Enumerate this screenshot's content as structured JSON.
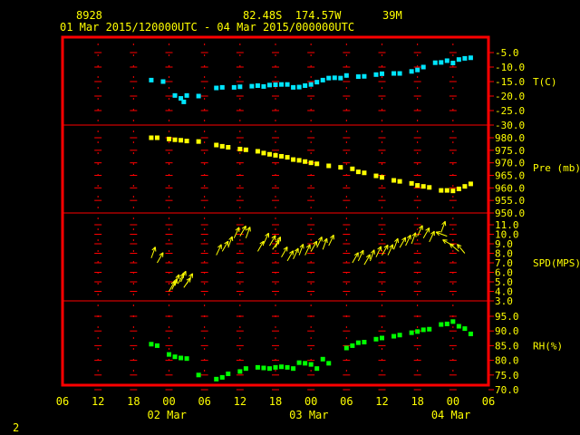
{
  "header": {
    "station": "8928",
    "location": "82.48S  174.57W",
    "elevation": "39M",
    "period": "01 Mar 2015/120000UTC - 04 Mar 2015/000000UTC"
  },
  "footer": {
    "page_number": "2"
  },
  "colors": {
    "background": "#000000",
    "frame": "#ff0000",
    "text": "#ffff00",
    "grid": "#ff0000",
    "temp": "#00e5ff",
    "pressure": "#ffff00",
    "wind": "#ffff00",
    "rh": "#00ff00"
  },
  "x_axis": {
    "tick_labels": [
      "06",
      "12",
      "18",
      "00",
      "06",
      "12",
      "18",
      "00",
      "06",
      "12",
      "18",
      "00",
      "06"
    ],
    "date_labels": [
      {
        "text": "02 Mar",
        "hour_index": 3
      },
      {
        "text": "03 Mar",
        "hour_index": 7
      },
      {
        "text": "04 Mar",
        "hour_index": 11
      }
    ]
  },
  "chart_data": [
    {
      "type": "scatter",
      "name": "temperature",
      "label": "T(C)",
      "ylim": [
        -30,
        -5
      ],
      "yticks": [
        "-5.0",
        "-10.0",
        "-15.0",
        "-20.0",
        "-25.0",
        "-30.0"
      ],
      "ytick_values": [
        -5,
        -10,
        -15,
        -20,
        -25,
        -30
      ],
      "x_hours": [
        15,
        17,
        19,
        20,
        20.5,
        21,
        23,
        26,
        27,
        29,
        30,
        32,
        33,
        34,
        35,
        36,
        37,
        38,
        39,
        40,
        41,
        42,
        43,
        44,
        45,
        46,
        47,
        48,
        50,
        51,
        53,
        54,
        56,
        57,
        59,
        60,
        61,
        63,
        64,
        65,
        66,
        67,
        68,
        69
      ],
      "values": [
        -14.5,
        -15,
        -19.8,
        -20.8,
        -22,
        -19.8,
        -20,
        -17.2,
        -17,
        -17,
        -16.8,
        -16.6,
        -16.4,
        -16.7,
        -16.2,
        -16.1,
        -16,
        -16,
        -17,
        -16.9,
        -16.4,
        -16,
        -15.2,
        -14.5,
        -13.8,
        -13.7,
        -13.8,
        -12.9,
        -13.3,
        -13.2,
        -12.6,
        -12.3,
        -12.2,
        -12.2,
        -11.5,
        -11,
        -10,
        -8.5,
        -8.4,
        -7.8,
        -8.6,
        -7.4,
        -7,
        -6.8
      ]
    },
    {
      "type": "scatter",
      "name": "pressure",
      "label": "Pre (mb)",
      "ylim": [
        950,
        980
      ],
      "yticks": [
        "980.0",
        "975.0",
        "970.0",
        "965.0",
        "960.0",
        "955.0",
        "950.0"
      ],
      "ytick_values": [
        980,
        975,
        970,
        965,
        960,
        955,
        950
      ],
      "x_hours": [
        15,
        16,
        18,
        19,
        20,
        21,
        23,
        26,
        27,
        28,
        30,
        31,
        33,
        34,
        35,
        36,
        37,
        38,
        39,
        40,
        41,
        42,
        43,
        45,
        47,
        49,
        50,
        51,
        53,
        54,
        56,
        57,
        59,
        60,
        61,
        62,
        64,
        65,
        66,
        67,
        68,
        69
      ],
      "values": [
        980,
        980,
        979.5,
        979.2,
        979,
        978.7,
        978.5,
        977.1,
        976.6,
        976.2,
        975.5,
        975.2,
        974.6,
        973.9,
        973.4,
        973,
        972.6,
        972.2,
        971.3,
        971,
        970.5,
        970,
        969.6,
        968.8,
        968.2,
        967.6,
        966.4,
        966,
        964.8,
        964.2,
        963,
        962.6,
        961.8,
        961,
        960.6,
        960.2,
        959,
        959,
        958.8,
        959.6,
        960.6,
        961.6
      ]
    },
    {
      "type": "vector",
      "name": "wind",
      "label": "SPD(MPS)",
      "ylim": [
        3,
        11
      ],
      "yticks": [
        "3.0",
        "4.0",
        "5.0",
        "6.0",
        "7.0",
        "8.0",
        "9.0",
        "10.0",
        "11.0"
      ],
      "ytick_values": [
        3,
        4,
        5,
        6,
        7,
        8,
        9,
        10,
        11
      ],
      "x_hours": [
        15,
        16,
        18,
        18.5,
        19,
        19.5,
        20,
        20.5,
        21,
        26,
        27,
        28,
        29,
        30,
        31,
        33,
        34,
        35,
        35.5,
        36,
        37,
        38,
        39,
        40,
        41,
        42,
        43,
        44,
        45,
        49,
        50,
        51,
        52,
        53,
        54,
        55,
        56,
        57,
        58,
        59,
        60,
        61,
        62,
        64,
        65,
        66,
        67,
        68
      ],
      "values": [
        7.5,
        7,
        4,
        4.2,
        4.6,
        4.8,
        5,
        4.4,
        4.8,
        7.8,
        8.2,
        8.6,
        9.6,
        9.8,
        9.6,
        8.2,
        9,
        8.8,
        8.4,
        8.6,
        7.6,
        7.2,
        7.4,
        7.8,
        7.8,
        8.2,
        8.6,
        8.4,
        8.8,
        7,
        7.2,
        6.8,
        7.2,
        7.6,
        7.8,
        7.8,
        8.4,
        8.6,
        8.8,
        9,
        9.8,
        9.6,
        9.2,
        10.2,
        9.8,
        8.8,
        8.2,
        8
      ],
      "directions_deg": [
        20,
        30,
        30,
        25,
        20,
        30,
        25,
        35,
        30,
        25,
        30,
        20,
        25,
        30,
        20,
        30,
        25,
        30,
        35,
        25,
        30,
        30,
        25,
        20,
        25,
        30,
        25,
        20,
        25,
        30,
        25,
        30,
        20,
        25,
        30,
        25,
        20,
        30,
        25,
        20,
        25,
        30,
        25,
        20,
        290,
        300,
        310,
        320
      ]
    },
    {
      "type": "scatter",
      "name": "relative_humidity",
      "label": "RH(%)",
      "ylim": [
        70,
        95
      ],
      "yticks": [
        "95.0",
        "90.0",
        "85.0",
        "80.0",
        "75.0",
        "70.0"
      ],
      "ytick_values": [
        95,
        90,
        85,
        80,
        75,
        70
      ],
      "x_hours": [
        15,
        16,
        18,
        19,
        20,
        21,
        23,
        26,
        27,
        28,
        30,
        31,
        33,
        34,
        35,
        36,
        37,
        38,
        39,
        40,
        41,
        42,
        43,
        44,
        45,
        48,
        49,
        50,
        51,
        53,
        54,
        56,
        57,
        59,
        60,
        61,
        62,
        64,
        65,
        66,
        67,
        68,
        69
      ],
      "values": [
        85.5,
        85,
        82,
        81.2,
        80.8,
        80.6,
        75,
        73.6,
        74.2,
        75.4,
        76.2,
        77.2,
        77.6,
        77.4,
        77.2,
        77.6,
        77.8,
        77.6,
        77.2,
        79.2,
        79,
        78.6,
        77.2,
        80.4,
        79,
        84.2,
        85,
        86,
        86.2,
        87.2,
        87.6,
        88.2,
        88.6,
        89.4,
        89.8,
        90.4,
        90.6,
        92.2,
        92.4,
        93.2,
        91.6,
        90.8,
        89
      ]
    }
  ]
}
